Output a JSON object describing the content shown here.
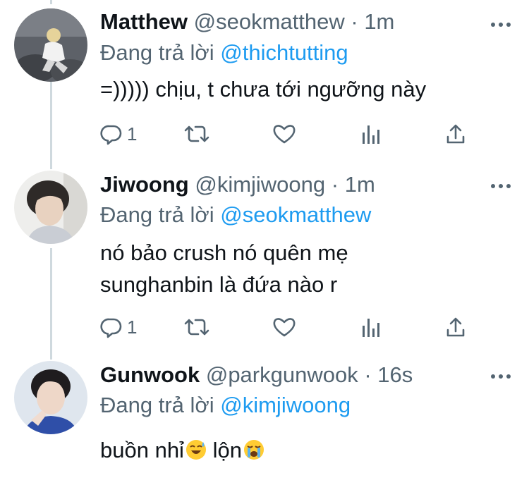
{
  "colors": {
    "accent": "#1d9bf0",
    "secondary_text": "#536471",
    "primary_text": "#0f1419",
    "thread_line": "#cfd9de"
  },
  "tweets": [
    {
      "name": "Matthew",
      "handle": "@seokmatthew",
      "separator": "·",
      "time": "1m",
      "replying_prefix": "Đang trả lời",
      "replying_to": "@thichtutting",
      "text_lines": [
        "=))))) chịu, t chưa tới ngưỡng này"
      ],
      "reply_count": "1",
      "icons": [
        "reply-icon",
        "retweet-icon",
        "like-icon",
        "analytics-icon",
        "share-icon",
        "more-icon"
      ]
    },
    {
      "name": "Jiwoong",
      "handle": "@kimjiwoong",
      "separator": "·",
      "time": "1m",
      "replying_prefix": "Đang trả lời",
      "replying_to": "@seokmatthew",
      "text_lines": [
        "nó bảo crush nó quên mẹ",
        "sunghanbin là đứa nào r"
      ],
      "reply_count": "1",
      "icons": [
        "reply-icon",
        "retweet-icon",
        "like-icon",
        "analytics-icon",
        "share-icon",
        "more-icon"
      ]
    },
    {
      "name": "Gunwook",
      "handle": "@parkgunwook",
      "separator": "·",
      "time": "16s",
      "replying_prefix": "Đang trả lời",
      "replying_to": "@kimjiwoong",
      "text_parts": [
        "buồn nhỉ",
        " lộn"
      ],
      "emojis": [
        "grinning-sweat-emoji",
        "crying-emoji"
      ],
      "icons": [
        "more-icon"
      ]
    }
  ]
}
